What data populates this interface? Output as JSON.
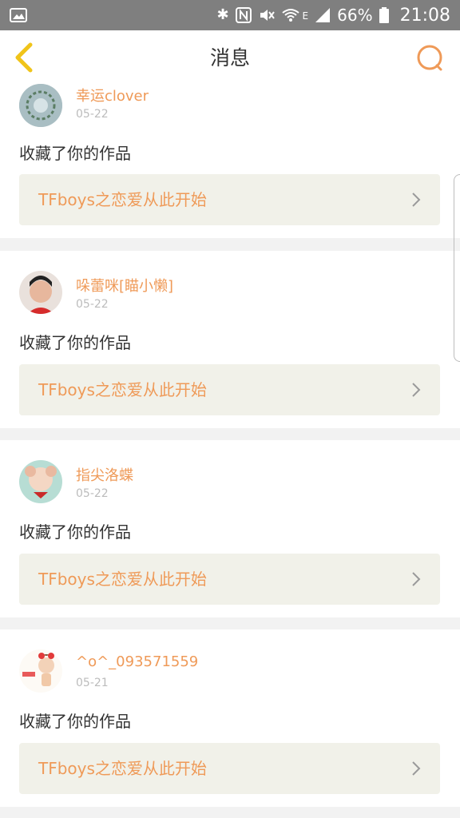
{
  "status_bar": {
    "battery_percent": "66%",
    "time": "21:08",
    "network_label": "E",
    "icons": [
      "image-icon",
      "bluetooth-icon",
      "nfc-icon",
      "mute-icon",
      "wifi-icon",
      "signal-icon",
      "battery-icon"
    ]
  },
  "header": {
    "title": "消息",
    "back_icon": "chevron-left-icon",
    "search_icon": "search-icon"
  },
  "colors": {
    "accent": "#ef9a58",
    "back_arrow": "#f0c419",
    "card_button_bg": "#f1f1e9",
    "status_bar_bg": "#7f7f7f"
  },
  "messages": [
    {
      "username": "幸运clover",
      "date": "05-22",
      "action": "收藏了你的作品",
      "work_title": "TFboys之恋爱从此开始"
    },
    {
      "username": "哚蕾咪[瞄小懒]",
      "date": "05-22",
      "action": "收藏了你的作品",
      "work_title": "TFboys之恋爱从此开始"
    },
    {
      "username": "指尖洛蝶",
      "date": "05-22",
      "action": "收藏了你的作品",
      "work_title": "TFboys之恋爱从此开始"
    },
    {
      "username": "^o^_093571559",
      "date": "05-21",
      "action": "收藏了你的作品",
      "work_title": "TFboys之恋爱从此开始"
    }
  ]
}
